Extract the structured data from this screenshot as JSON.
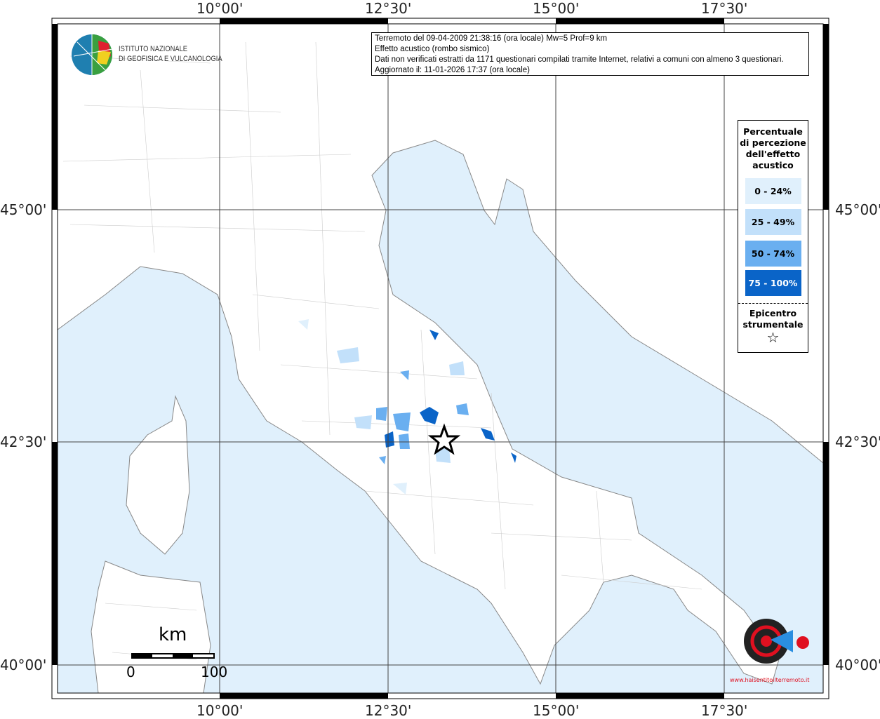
{
  "axes": {
    "lon_labels": [
      "10°00'",
      "12°30'",
      "15°00'",
      "17°30'"
    ],
    "lat_labels": [
      "45°00'",
      "42°30'",
      "40°00'"
    ]
  },
  "info": {
    "lines": [
      "Terremoto del 09-04-2009 21:38:16 (ora locale) Mw=5 Prof=9 km",
      "Effetto acustico (rombo sismico)",
      "Dati non verificati estratti da 1171 questionari compilati tramite Internet, relativi a comuni con almeno 3 questionari.",
      "Aggiornato il: 11-01-2026 17:37 (ora locale)"
    ]
  },
  "legend": {
    "title": "Percentuale di percezione dell'effetto acustico",
    "classes": [
      {
        "label": "0 - 24%",
        "color": "#e0f0fc"
      },
      {
        "label": "25 - 49%",
        "color": "#c2e0fa"
      },
      {
        "label": "50 - 74%",
        "color": "#6aaff0"
      },
      {
        "label": "75 - 100%",
        "color": "#0a64c8"
      }
    ],
    "epicenter_label": "Epicentro strumentale"
  },
  "logo": {
    "line1": "ISTITUTO NAZIONALE",
    "line2": "DI GEOFISICA E VULCANOLOGIA"
  },
  "badge": {
    "text": "www.haisentitoilterremoto.it"
  },
  "scale": {
    "unit": "km",
    "min": "0",
    "max": "100"
  },
  "colors": {
    "sea": "#e0f0fc",
    "land": "#ffffff"
  }
}
